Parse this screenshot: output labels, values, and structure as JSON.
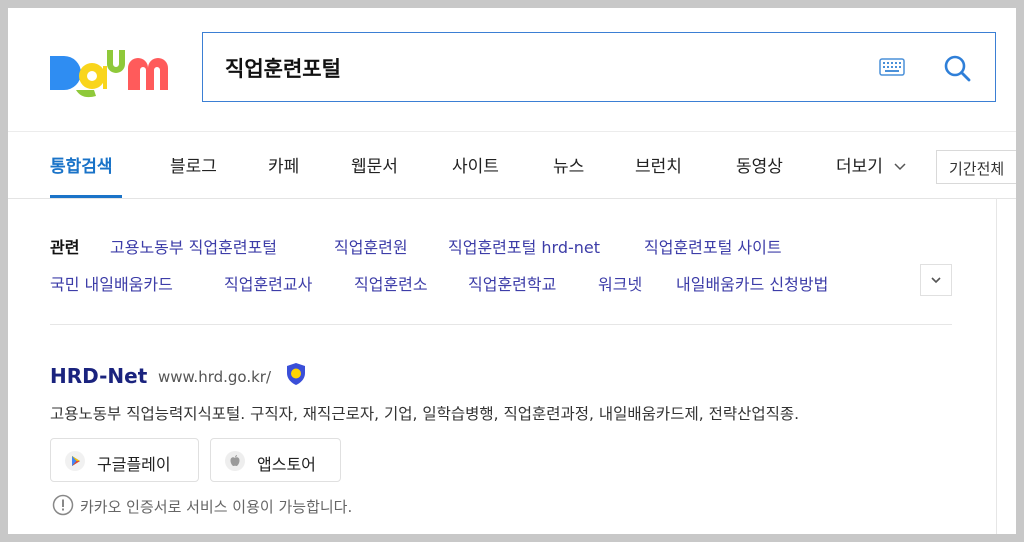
{
  "brand": {
    "logo_letters": [
      "D",
      "a",
      "u",
      "m"
    ]
  },
  "search": {
    "query": "직업훈련포털",
    "keyboard_icon": "keyboard-icon",
    "search_icon": "search-icon"
  },
  "tabs": {
    "items": [
      {
        "label": "통합검색",
        "active": true
      },
      {
        "label": "블로그"
      },
      {
        "label": "카페"
      },
      {
        "label": "웹문서"
      },
      {
        "label": "사이트"
      },
      {
        "label": "뉴스"
      },
      {
        "label": "브런치"
      },
      {
        "label": "동영상"
      },
      {
        "label": "더보기"
      }
    ],
    "period": "기간전체"
  },
  "related": {
    "label": "관련",
    "row1": [
      "고용노동부 직업훈련포털",
      "직업훈련원",
      "직업훈련포털 hrd-net",
      "직업훈련포털 사이트"
    ],
    "row2": [
      "국민 내일배움카드",
      "직업훈련교사",
      "직업훈련소",
      "직업훈련학교",
      "워크넷",
      "내일배움카드 신청방법"
    ]
  },
  "result": {
    "title": "HRD-Net",
    "url": "www.hrd.go.kr/",
    "description": "고용노동부 직업능력지식포털. 구직자, 재직근로자, 기업, 일학습병행, 직업훈련과정, 내일배움카드제, 전략산업직종.",
    "apps": {
      "google_play": "구글플레이",
      "app_store": "앱스토어"
    },
    "notice": "카카오 인증서로 서비스 이용이 가능합니다."
  },
  "colors": {
    "accent": "#1a73c8",
    "link": "#3d3da8",
    "title": "#1a237e"
  }
}
